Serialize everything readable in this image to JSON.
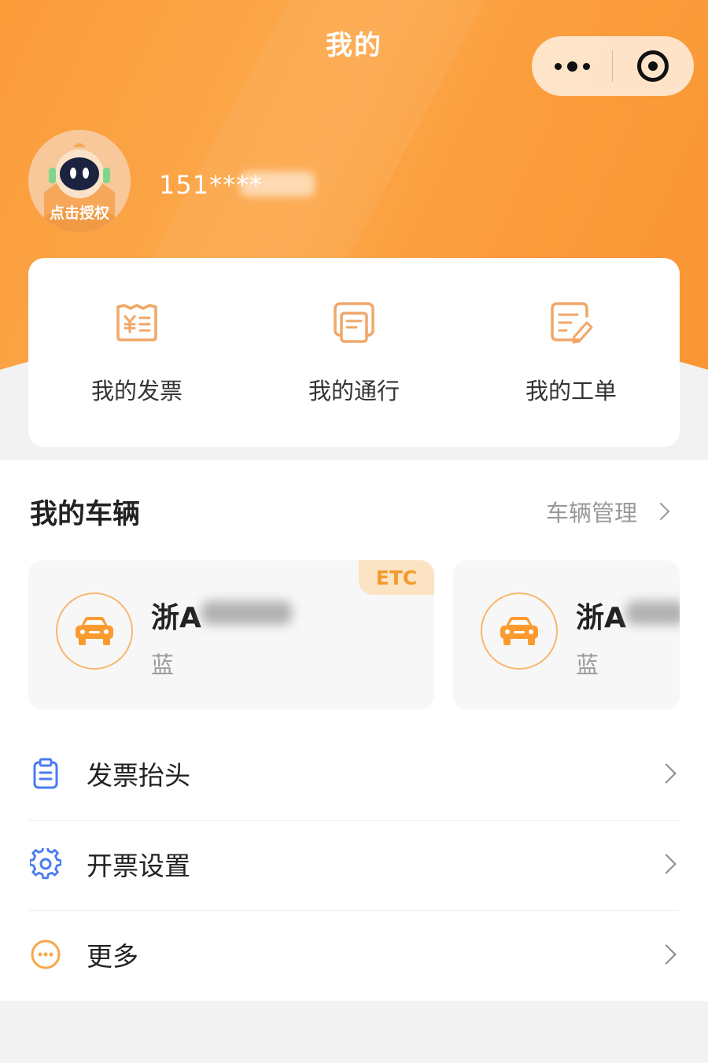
{
  "header": {
    "title": "我的",
    "capsule": {
      "more_icon": "more-dots-icon",
      "close_icon": "target-close-icon"
    }
  },
  "profile": {
    "avatar_label": "点击授权",
    "phone": "151****"
  },
  "quick_actions": [
    {
      "label": "我的发票",
      "icon": "invoice-icon"
    },
    {
      "label": "我的通行",
      "icon": "pass-record-icon"
    },
    {
      "label": "我的工单",
      "icon": "work-order-icon"
    }
  ],
  "vehicles": {
    "title": "我的车辆",
    "manage_label": "车辆管理",
    "items": [
      {
        "plate": "浙A",
        "color": "蓝",
        "badge": "ETC"
      },
      {
        "plate": "浙A",
        "color": "蓝"
      }
    ]
  },
  "menu": [
    {
      "label": "发票抬头",
      "icon": "clipboard-icon"
    },
    {
      "label": "开票设置",
      "icon": "gear-icon"
    },
    {
      "label": "更多",
      "icon": "more-circle-icon"
    }
  ],
  "colors": {
    "accent": "#fb9b3a",
    "icon_blue": "#4a7bf0",
    "icon_orange": "#f9a64a"
  }
}
